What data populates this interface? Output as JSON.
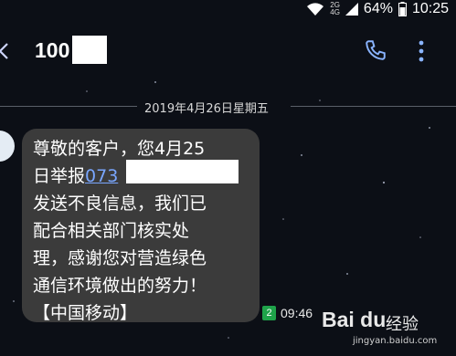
{
  "status_bar": {
    "network_top": "2G",
    "network_bottom": "4G",
    "battery": "64%",
    "time": "10:25",
    "icons": [
      "wifi-icon",
      "signal-icon",
      "battery-icon"
    ]
  },
  "header": {
    "title": "100",
    "icons": [
      "back-icon",
      "phone-icon",
      "more-icon"
    ],
    "accent_color": "#8ab4ff"
  },
  "conversation": {
    "date": "2019年4月26日星期五",
    "message": {
      "lines": [
        "尊敬的客户，您4月25",
        "日举报",
        "发送不良信息，我们已",
        "配合相关部门核实处",
        "理，感谢您对营造绿色",
        "通信环境做出的努力！",
        "【中国移动】"
      ],
      "link_text": "073",
      "sim": "2",
      "time": "09:46"
    }
  },
  "watermark": {
    "logo": "Bai du",
    "text": "经验",
    "url": "jingyan.baidu.com"
  }
}
